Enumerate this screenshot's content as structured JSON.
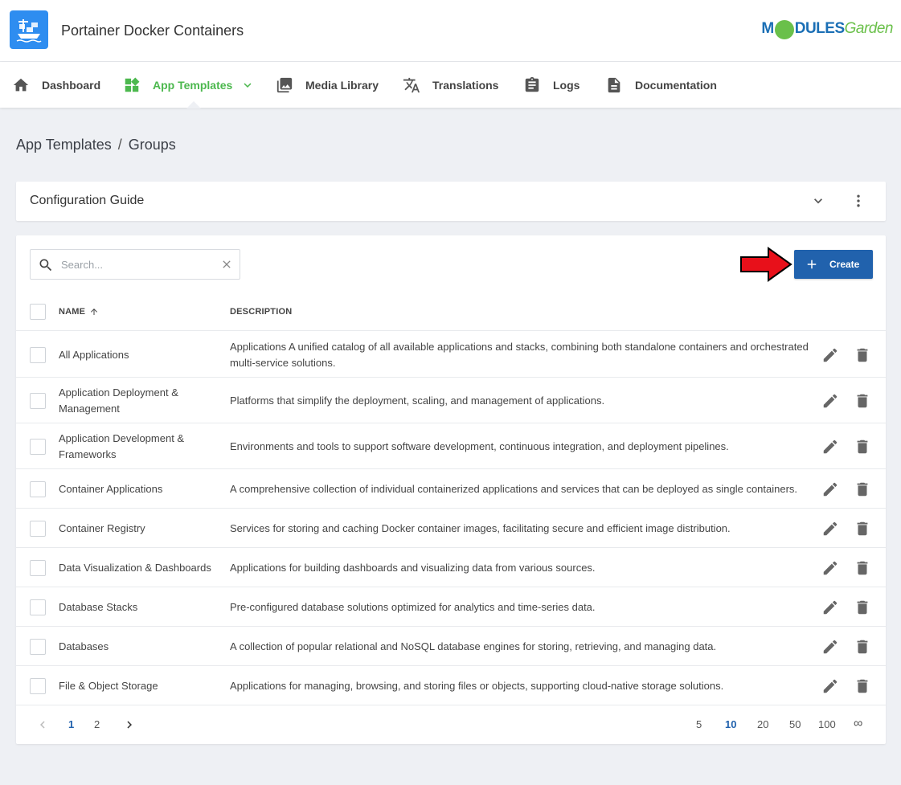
{
  "header": {
    "app_title": "Portainer Docker Containers",
    "brand_left": "M",
    "brand_mid": "DULES",
    "brand_right": "Garden"
  },
  "nav": [
    {
      "label": "Dashboard",
      "icon": "home-icon"
    },
    {
      "label": "App Templates",
      "icon": "widgets-icon",
      "active": true
    },
    {
      "label": "Media Library",
      "icon": "image-icon"
    },
    {
      "label": "Translations",
      "icon": "translate-icon"
    },
    {
      "label": "Logs",
      "icon": "clipboard-icon"
    },
    {
      "label": "Documentation",
      "icon": "document-icon"
    }
  ],
  "breadcrumb": {
    "parent": "App Templates",
    "separator": "/",
    "current": "Groups"
  },
  "guide": {
    "title": "Configuration Guide"
  },
  "toolbar": {
    "search_placeholder": "Search...",
    "search_value": "",
    "create_label": "Create"
  },
  "table": {
    "columns": {
      "name": "NAME",
      "description": "DESCRIPTION"
    },
    "rows": [
      {
        "name": "All Applications",
        "description": "Applications A unified catalog of all available applications and stacks, combining both standalone containers and orchestrated multi-service solutions."
      },
      {
        "name": "Application Deployment & Management",
        "description": "Platforms that simplify the deployment, scaling, and management of applications."
      },
      {
        "name": "Application Development & Frameworks",
        "description": "Environments and tools to support software development, continuous integration, and deployment pipelines."
      },
      {
        "name": "Container Applications",
        "description": "A comprehensive collection of individual containerized applications and services that can be deployed as single containers."
      },
      {
        "name": "Container Registry",
        "description": "Services for storing and caching Docker container images, facilitating secure and efficient image distribution."
      },
      {
        "name": "Data Visualization & Dashboards",
        "description": "Applications for building dashboards and visualizing data from various sources."
      },
      {
        "name": "Database Stacks",
        "description": "Pre-configured database solutions optimized for analytics and time-series data."
      },
      {
        "name": "Databases",
        "description": "A collection of popular relational and NoSQL database engines for storing, retrieving, and managing data."
      },
      {
        "name": "File & Object Storage",
        "description": "Applications for managing, browsing, and storing files or objects, supporting cloud-native storage solutions."
      }
    ]
  },
  "pagination": {
    "pages": [
      "1",
      "2"
    ],
    "current_page": "1",
    "page_sizes": [
      "5",
      "10",
      "20",
      "50",
      "100",
      "∞"
    ],
    "current_size": "10"
  },
  "colors": {
    "accent": "#2162ad",
    "active_nav": "#4cb84e",
    "arrow": "#e8101a"
  }
}
